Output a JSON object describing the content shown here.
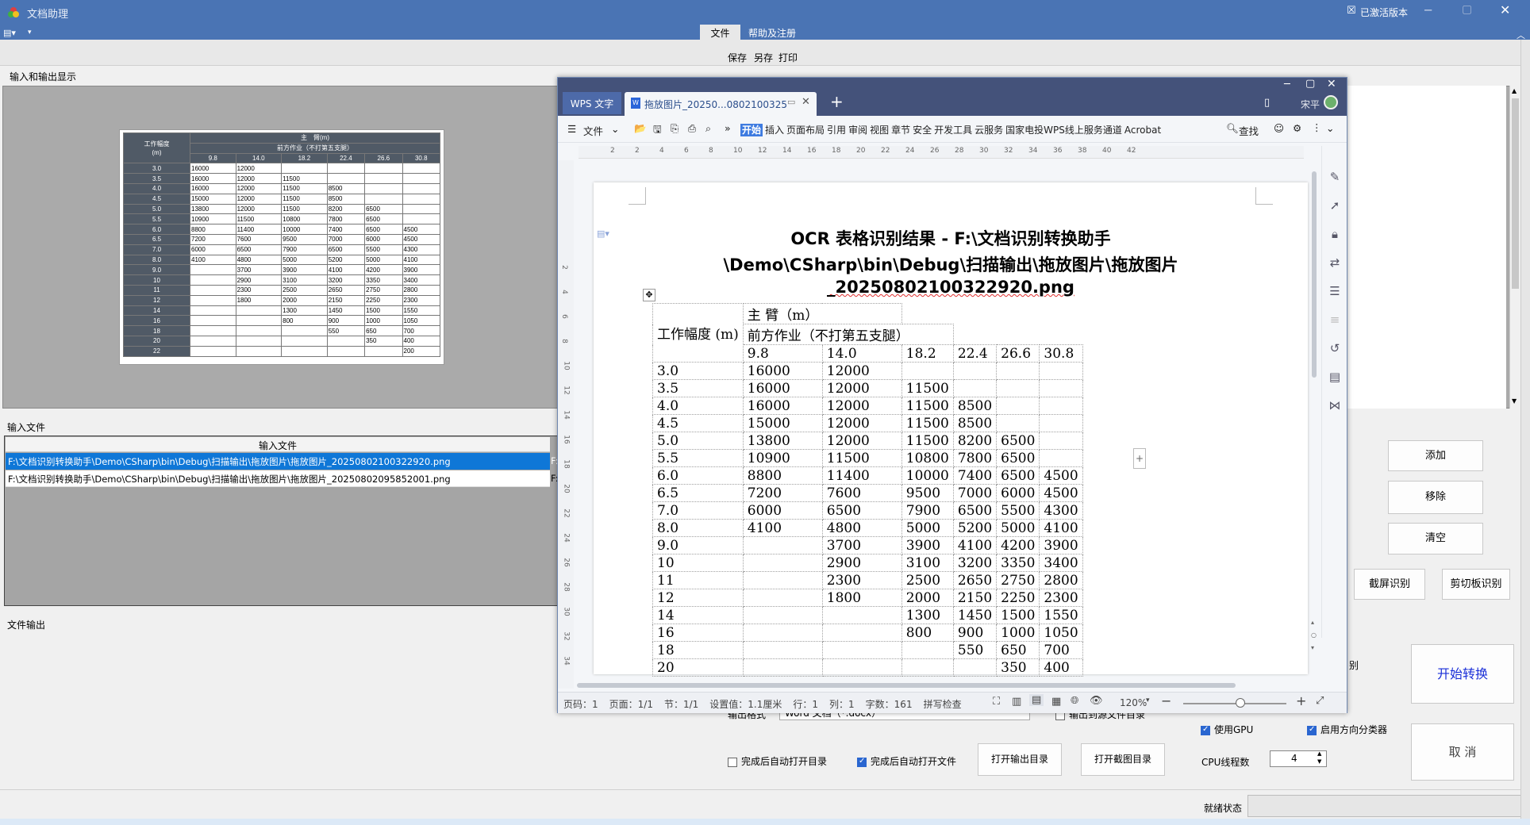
{
  "app": {
    "title": "文档助理",
    "activated": "已激活版本"
  },
  "ribbon": {
    "tabs": [
      "文件",
      "帮助及注册"
    ],
    "actions": [
      "保存",
      "另存",
      "打印"
    ]
  },
  "io_display": {
    "label": "输入和输出显示"
  },
  "input_files": {
    "label": "输入文件",
    "column_header": "输入文件",
    "rows": [
      "F:\\文档识别转换助手\\Demo\\CSharp\\bin\\Debug\\扫描输出\\拖放图片\\拖放图片_20250802100322920.png",
      "F:\\文档识别转换助手\\Demo\\CSharp\\bin\\Debug\\扫描输出\\拖放图片\\拖放图片_20250802095852001.png"
    ],
    "col2_cut": "F:"
  },
  "file_output": {
    "label": "文件输出"
  },
  "buttons": {
    "add": "添加",
    "remove": "移除",
    "clear": "清空",
    "screen_ocr": "截屏识别",
    "clipboard_ocr": "剪切板识别",
    "start": "开始转换",
    "cancel": "取 消",
    "open_output_dir": "打开输出目录",
    "open_capture_dir": "打开截图目录"
  },
  "options": {
    "output_format_label": "输出格式",
    "output_format_value": "Word 文档（*.docx）",
    "output_mirror": "输出到源文件目录",
    "auto_open_dir": "完成后自动打开目录",
    "auto_open_file": "完成后自动打开文件",
    "use_gpu": "使用GPU",
    "direction_classifier": "启用方向分类器",
    "cpu_threads_label": "CPU线程数",
    "cpu_threads": "4",
    "cut_text": "别"
  },
  "status": {
    "label": "就绪状态"
  },
  "wps": {
    "tab_app": "WPS 文字",
    "tab_doc": "拖放图片_20250...0802100325",
    "user": "宋平",
    "menu_file": "文件",
    "menus": [
      "开始",
      "插入",
      "页面布局",
      "引用",
      "审阅",
      "视图",
      "章节",
      "安全",
      "开发工具",
      "云服务",
      "国家电投WPS线上服务通道",
      "Acrobat"
    ],
    "search": "查找",
    "ruler_h": [
      "2",
      "2",
      "4",
      "6",
      "8",
      "10",
      "12",
      "14",
      "16",
      "18",
      "20",
      "22",
      "24",
      "26",
      "28",
      "30",
      "32",
      "34",
      "36",
      "38",
      "40",
      "42"
    ],
    "ruler_v": [
      "2",
      "4",
      "6",
      "8",
      "10",
      "12",
      "14",
      "16",
      "18",
      "20",
      "22",
      "24",
      "26",
      "28",
      "30",
      "32",
      "34"
    ],
    "doc_title_1": "OCR 表格识别结果 - F:\\文档识别转换助手",
    "doc_title_2": "\\Demo\\CSharp\\bin\\Debug\\扫描输出\\拖放图片\\拖放图片",
    "doc_title_3": "_20250802100322920.png",
    "status_items": [
      "页码：1",
      "页面：1/1",
      "节：1/1",
      "设置值：1.1厘米",
      "行：1",
      "列：1",
      "字数：161",
      "拼写检查"
    ],
    "zoom": "120%"
  },
  "table": {
    "h_work": "工作幅度 (m)",
    "h_main": "主 臂（m）",
    "h_front": "前方作业（不打第五支腿）",
    "cols": [
      "9.8",
      "14.0",
      "18.2",
      "22.4",
      "26.6",
      "30.8"
    ],
    "rows": [
      [
        "3.0",
        "16000",
        "12000",
        "",
        "",
        "",
        ""
      ],
      [
        "3.5",
        "16000",
        "12000",
        "11500",
        "",
        "",
        ""
      ],
      [
        "4.0",
        "16000",
        "12000",
        "11500",
        "8500",
        "",
        ""
      ],
      [
        "4.5",
        "15000",
        "12000",
        "11500",
        "8500",
        "",
        ""
      ],
      [
        "5.0",
        "13800",
        "12000",
        "11500",
        "8200",
        "6500",
        ""
      ],
      [
        "5.5",
        "10900",
        "11500",
        "10800",
        "7800",
        "6500",
        ""
      ],
      [
        "6.0",
        "8800",
        "11400",
        "10000",
        "7400",
        "6500",
        "4500"
      ],
      [
        "6.5",
        "7200",
        "7600",
        "9500",
        "7000",
        "6000",
        "4500"
      ],
      [
        "7.0",
        "6000",
        "6500",
        "7900",
        "6500",
        "5500",
        "4300"
      ],
      [
        "8.0",
        "4100",
        "4800",
        "5000",
        "5200",
        "5000",
        "4100"
      ],
      [
        "9.0",
        "",
        "3700",
        "3900",
        "4100",
        "4200",
        "3900"
      ],
      [
        "10",
        "",
        "2900",
        "3100",
        "3200",
        "3350",
        "3400"
      ],
      [
        "11",
        "",
        "2300",
        "2500",
        "2650",
        "2750",
        "2800"
      ],
      [
        "12",
        "",
        "1800",
        "2000",
        "2150",
        "2250",
        "2300"
      ],
      [
        "14",
        "",
        "",
        "1300",
        "1450",
        "1500",
        "1550"
      ],
      [
        "16",
        "",
        "",
        "800",
        "900",
        "1000",
        "1050"
      ],
      [
        "18",
        "",
        "",
        "",
        "550",
        "650",
        "700"
      ],
      [
        "20",
        "",
        "",
        "",
        "",
        "350",
        "400"
      ],
      [
        "22",
        "",
        "",
        "",
        "",
        "",
        "200"
      ]
    ],
    "img_h_work": "工作幅度\n(m)",
    "img_h_main": "主　臂(m)",
    "img_h_front": "前方作业（不打第五支腿）"
  }
}
